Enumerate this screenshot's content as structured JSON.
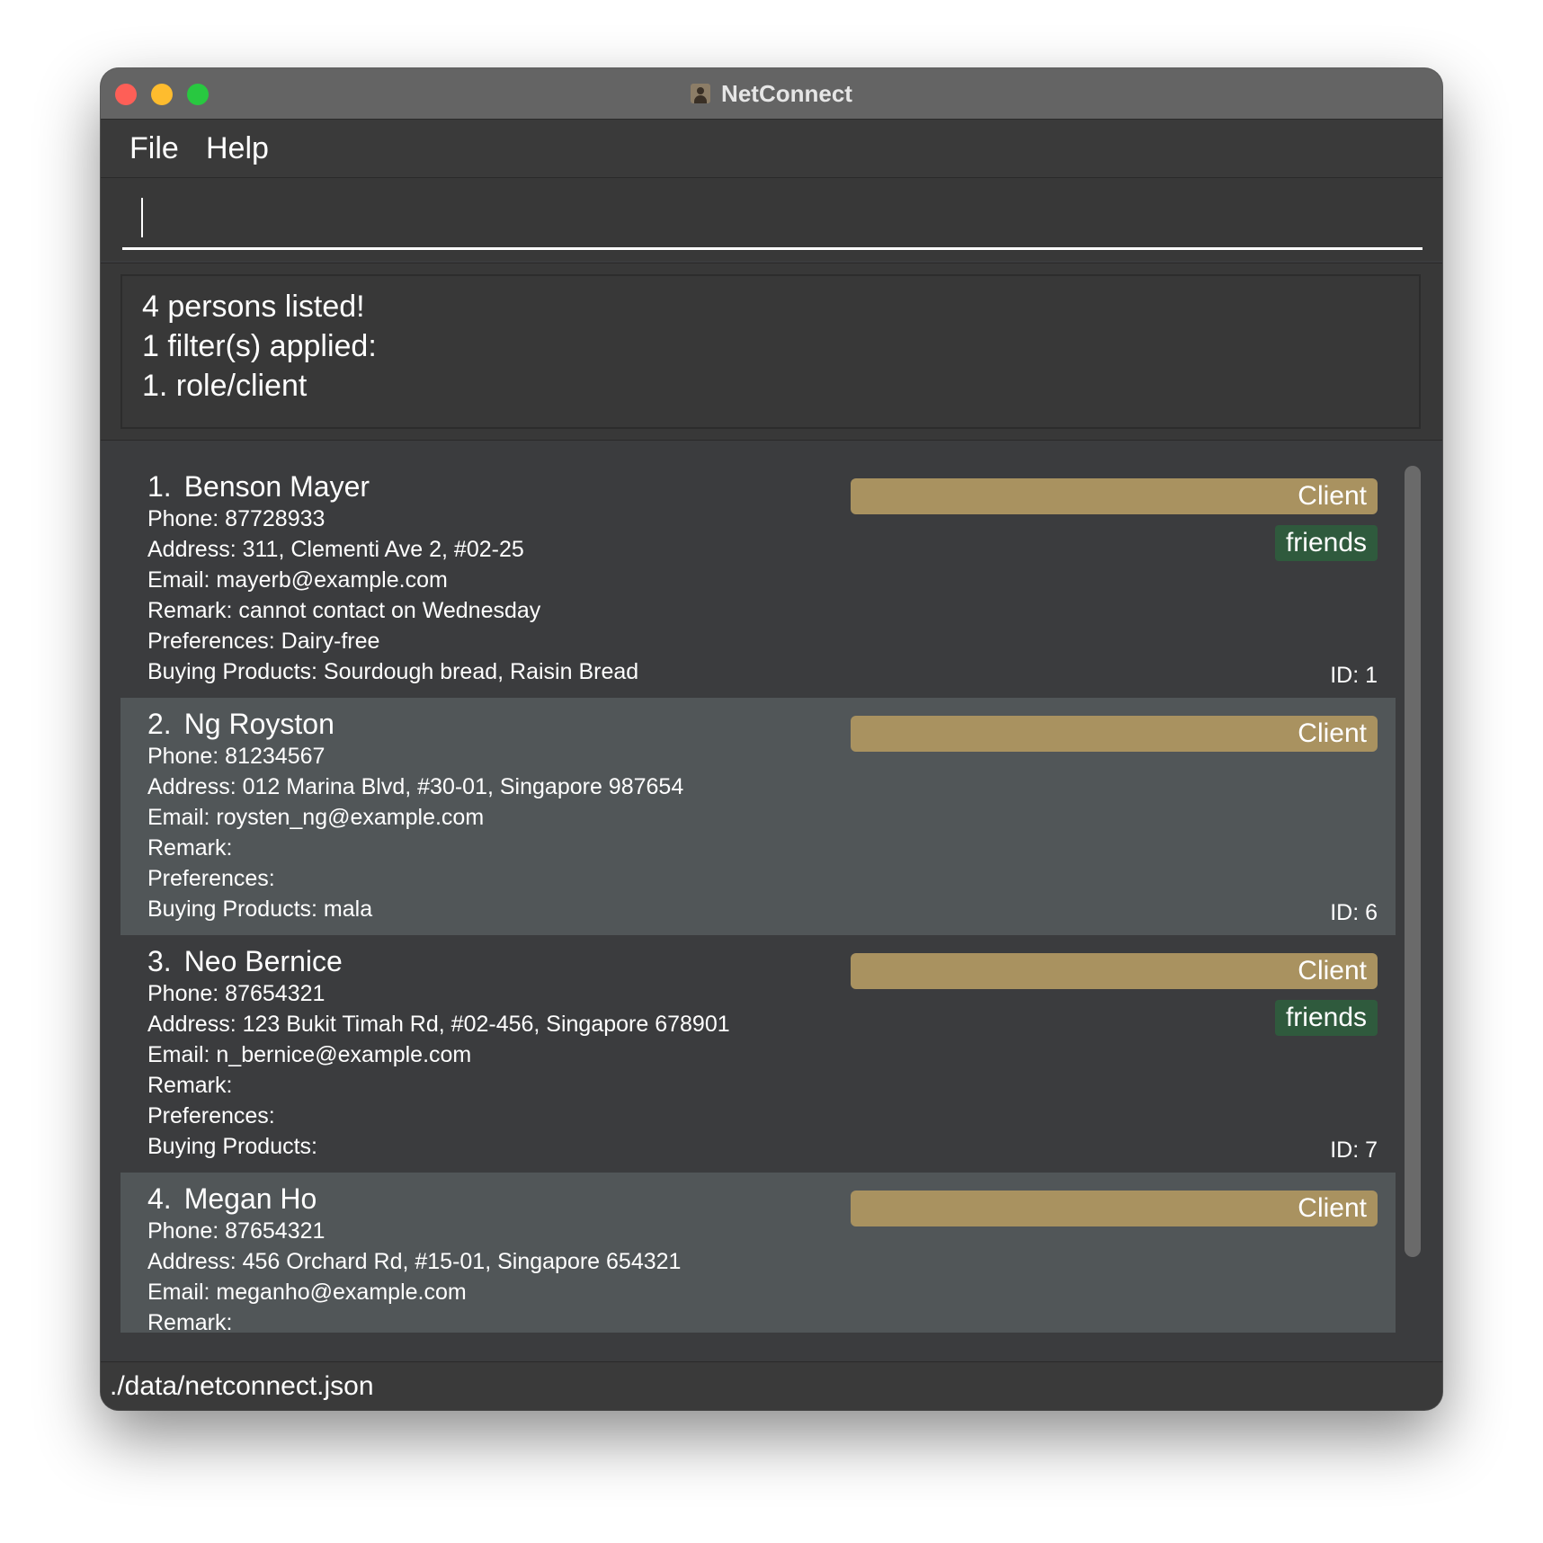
{
  "window": {
    "title": "NetConnect"
  },
  "menu": {
    "file": "File",
    "help": "Help"
  },
  "command": {
    "value": "",
    "placeholder": ""
  },
  "result": {
    "lines": [
      "4 persons listed!",
      "1 filter(s) applied:",
      "1. role/client"
    ]
  },
  "persons": [
    {
      "index": "1.",
      "name": "Benson Mayer",
      "phone": "Phone: 87728933",
      "address": "Address: 311, Clementi Ave 2, #02-25",
      "email": "Email: mayerb@example.com",
      "remark": "Remark: cannot contact on Wednesday",
      "preferences": "Preferences: Dairy-free",
      "buying": "Buying Products: Sourdough bread, Raisin Bread",
      "role": "Client",
      "tag": "friends",
      "id": "ID: 1"
    },
    {
      "index": "2.",
      "name": "Ng Royston",
      "phone": "Phone: 81234567",
      "address": "Address: 012 Marina Blvd, #30-01, Singapore 987654",
      "email": "Email: roysten_ng@example.com",
      "remark": "Remark:",
      "preferences": "Preferences:",
      "buying": "Buying Products: mala",
      "role": "Client",
      "id": "ID: 6"
    },
    {
      "index": "3.",
      "name": "Neo Bernice",
      "phone": "Phone: 87654321",
      "address": "Address: 123 Bukit Timah Rd, #02-456, Singapore 678901",
      "email": "Email: n_bernice@example.com",
      "remark": "Remark:",
      "preferences": "Preferences:",
      "buying": "Buying Products:",
      "role": "Client",
      "tag": "friends",
      "id": "ID: 7"
    },
    {
      "index": "4.",
      "name": "Megan Ho",
      "phone": "Phone: 87654321",
      "address": "Address: 456 Orchard Rd, #15-01, Singapore 654321",
      "email": "Email: meganho@example.com",
      "remark": "Remark:",
      "role": "Client"
    }
  ],
  "status": {
    "path": "./data/netconnect.json"
  },
  "colors": {
    "role_tag": "#a99260",
    "friend_tag": "#2f5a3d",
    "card_odd": "#3b3c3e",
    "card_even": "#515658"
  }
}
